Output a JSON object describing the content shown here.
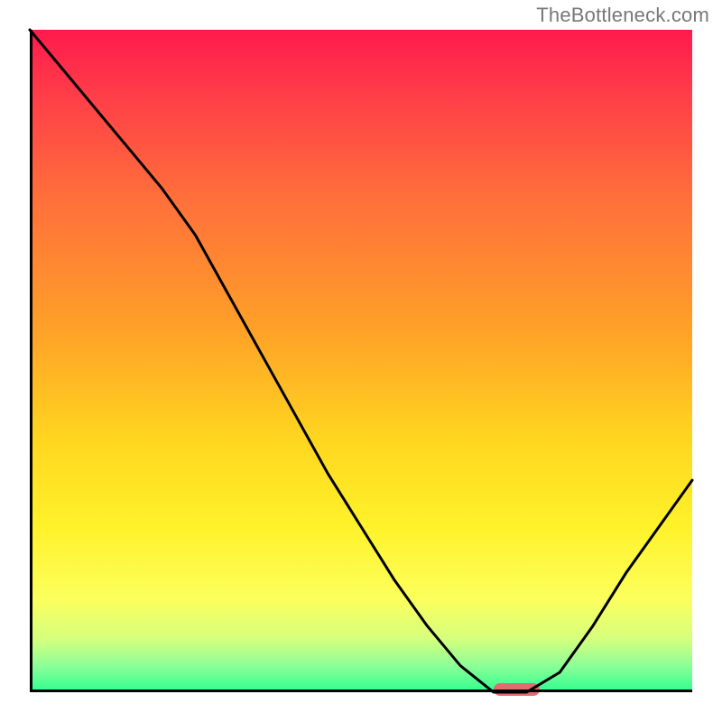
{
  "watermark": "TheBottleneck.com",
  "colors": {
    "gradient_top": "#ff1a4d",
    "gradient_bottom": "#2fff8f",
    "curve": "#000000",
    "axis": "#000000",
    "marker": "#e26b6f"
  },
  "chart_data": {
    "type": "line",
    "title": "",
    "xlabel": "",
    "ylabel": "",
    "xlim": [
      0,
      100
    ],
    "ylim": [
      0,
      100
    ],
    "x": [
      0,
      5,
      10,
      15,
      20,
      25,
      30,
      35,
      40,
      45,
      50,
      55,
      60,
      65,
      70,
      75,
      80,
      85,
      90,
      95,
      100
    ],
    "y": [
      100,
      94,
      88,
      82,
      76,
      69,
      60,
      51,
      42,
      33,
      25,
      17,
      10,
      4,
      0,
      0,
      3,
      10,
      18,
      25,
      32
    ],
    "optimum_range_x": [
      70,
      77
    ],
    "grid": false,
    "legend": false
  }
}
